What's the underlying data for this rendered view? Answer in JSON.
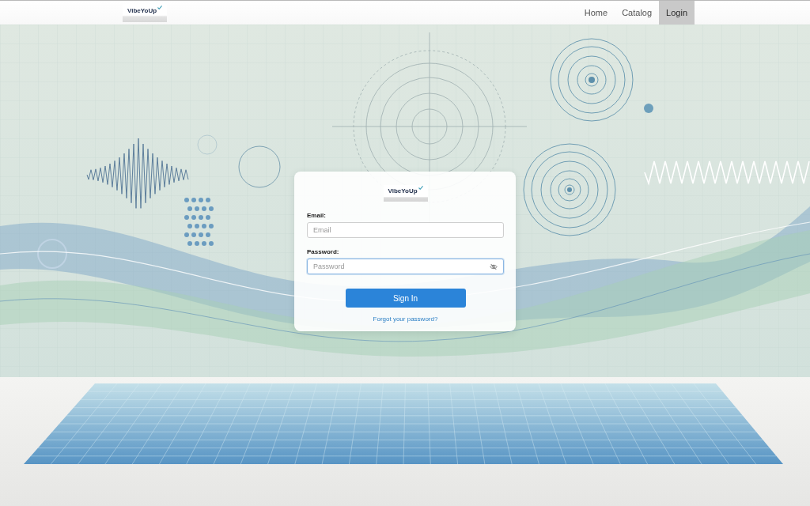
{
  "nav": {
    "logo": {
      "text": "VibeYoUp"
    },
    "links": [
      {
        "label": "Home",
        "selected": false
      },
      {
        "label": "Catalog",
        "selected": false
      },
      {
        "label": "Login",
        "selected": true
      }
    ]
  },
  "login_card": {
    "logo": {
      "text": "VibeYoUp"
    },
    "fields": [
      {
        "kind": "text",
        "label": "Email:",
        "placeholder": "Email",
        "focused": false
      },
      {
        "kind": "password",
        "label": "Password:",
        "placeholder": "Password",
        "focused": true
      }
    ],
    "submit": "Sign In",
    "forgot_link": "Forgot your password?"
  }
}
